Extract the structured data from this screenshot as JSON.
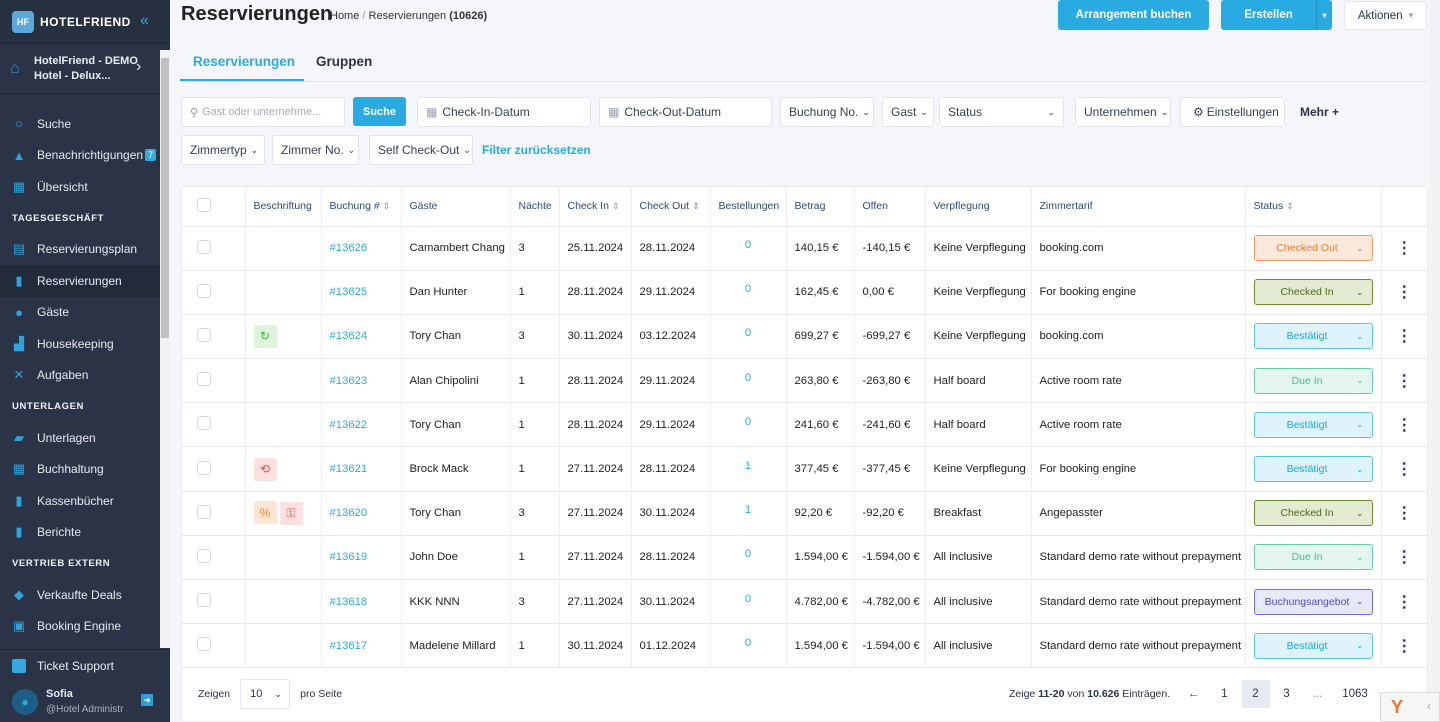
{
  "app": {
    "brand": "HOTELFRIEND",
    "logo_text": "HF"
  },
  "sidebar": {
    "hotel_line1": "HotelFriend - DEMO",
    "hotel_line2": "Hotel - Delux...",
    "items_top": [
      {
        "label": "Suche",
        "icon": "search-icon"
      },
      {
        "label": "Benachrichtigungen",
        "icon": "bell-icon",
        "badge": "7"
      },
      {
        "label": "Übersicht",
        "icon": "dashboard-icon"
      }
    ],
    "section_tagesgeschaeft": "TAGESGESCHÄFT",
    "items_tages": [
      {
        "label": "Reservierungsplan",
        "icon": "calendar-icon"
      },
      {
        "label": "Reservierungen",
        "icon": "document-icon",
        "active": true
      },
      {
        "label": "Gäste",
        "icon": "user-icon"
      },
      {
        "label": "Housekeeping",
        "icon": "broom-icon"
      },
      {
        "label": "Aufgaben",
        "icon": "tools-icon"
      }
    ],
    "section_unterlagen": "UNTERLAGEN",
    "items_unterlagen": [
      {
        "label": "Unterlagen",
        "icon": "folder-icon"
      },
      {
        "label": "Buchhaltung",
        "icon": "calculator-icon"
      },
      {
        "label": "Kassenbücher",
        "icon": "cashbook-icon"
      },
      {
        "label": "Berichte",
        "icon": "clipboard-icon"
      }
    ],
    "section_vertrieb": "VERTRIEB EXTERN",
    "items_vertrieb": [
      {
        "label": "Verkaufte Deals",
        "icon": "tag-icon"
      },
      {
        "label": "Booking Engine",
        "icon": "booking-engine-icon"
      }
    ],
    "ticket_support": "Ticket Support",
    "user_name": "Sofia",
    "user_role": "@Hotel Administr"
  },
  "header": {
    "title": "Reservierungen",
    "breadcrumb_home": "Home",
    "breadcrumb_sep": " / ",
    "breadcrumb_current": "Reservierungen",
    "breadcrumb_count": "(10626)",
    "btn_arrangement": "Arrangement buchen",
    "btn_erstellen": "Erstellen",
    "btn_aktionen": "Aktionen"
  },
  "tabs": [
    {
      "label": "Reservierungen",
      "active": true
    },
    {
      "label": "Gruppen",
      "active": false
    }
  ],
  "filters": {
    "search_placeholder": "Gast oder unternehme...",
    "search_button": "Suche",
    "checkin": "Check-In-Datum",
    "checkout": "Check-Out-Datum",
    "buchung_no": "Buchung No.",
    "gast": "Gast",
    "status": "Status",
    "unternehmen": "Unternehmen",
    "einstellungen": "Einstellungen",
    "mehr": "Mehr +",
    "zimmertyp": "Zimmertyp",
    "zimmer_no": "Zimmer No.",
    "self_checkout": "Self Check-Out",
    "reset": "Filter zurücksetzen"
  },
  "table": {
    "columns": [
      "",
      "Beschriftung",
      "Buchung #",
      "Gäste",
      "Nächte",
      "Check In",
      "Check Out",
      "Bestellungen",
      "Betrag",
      "Offen",
      "Verpflegung",
      "Zimmertarif",
      "Status",
      ""
    ],
    "rows": [
      {
        "tags": [],
        "booking": "#13626",
        "guest": "Camambert Chang",
        "nights": "3",
        "checkin": "25.11.2024",
        "checkout": "28.11.2024",
        "orders": "0",
        "amount": "140,15 €",
        "open": "-140,15 €",
        "board": "Keine Verpflegung",
        "rate": "booking.com",
        "status": "Checked Out",
        "status_type": "checked-out"
      },
      {
        "tags": [],
        "booking": "#13625",
        "guest": "Dan Hunter",
        "nights": "1",
        "checkin": "28.11.2024",
        "checkout": "29.11.2024",
        "orders": "0",
        "amount": "162,45 €",
        "open": "0,00 €",
        "board": "Keine Verpflegung",
        "rate": "For booking engine",
        "status": "Checked In",
        "status_type": "checked-in"
      },
      {
        "tags": [
          "recurring"
        ],
        "booking": "#13624",
        "guest": "Tory Chan",
        "nights": "3",
        "checkin": "30.11.2024",
        "checkout": "03.12.2024",
        "orders": "0",
        "amount": "699,27 €",
        "open": "-699,27 €",
        "board": "Keine Verpflegung",
        "rate": "booking.com",
        "status": "Bestätigt",
        "status_type": "confirmed"
      },
      {
        "tags": [],
        "booking": "#13623",
        "guest": "Alan Chipolini",
        "nights": "1",
        "checkin": "28.11.2024",
        "checkout": "29.11.2024",
        "orders": "0",
        "amount": "263,80 €",
        "open": "-263,80 €",
        "board": "Half board",
        "rate": "Active room rate",
        "status": "Due In",
        "status_type": "due-in"
      },
      {
        "tags": [],
        "booking": "#13622",
        "guest": "Tory Chan",
        "nights": "1",
        "checkin": "28.11.2024",
        "checkout": "29.11.2024",
        "orders": "0",
        "amount": "241,60 €",
        "open": "-241,60 €",
        "board": "Half board",
        "rate": "Active room rate",
        "status": "Bestätigt",
        "status_type": "confirmed"
      },
      {
        "tags": [
          "history"
        ],
        "booking": "#13621",
        "guest": "Brock Mack",
        "nights": "1",
        "checkin": "27.11.2024",
        "checkout": "28.11.2024",
        "orders": "1",
        "amount": "377,45 €",
        "open": "-377,45 €",
        "board": "Keine Verpflegung",
        "rate": "For booking engine",
        "status": "Bestätigt",
        "status_type": "confirmed"
      },
      {
        "tags": [
          "discount",
          "key"
        ],
        "booking": "#13620",
        "guest": "Tory Chan",
        "nights": "3",
        "checkin": "27.11.2024",
        "checkout": "30.11.2024",
        "orders": "1",
        "amount": "92,20 €",
        "open": "-92,20 €",
        "board": "Breakfast",
        "rate": "Angepasster",
        "status": "Checked In",
        "status_type": "checked-in"
      },
      {
        "tags": [],
        "booking": "#13619",
        "guest": "John Doe",
        "nights": "1",
        "checkin": "27.11.2024",
        "checkout": "28.11.2024",
        "orders": "0",
        "amount": "1.594,00 €",
        "open": "-1.594,00 €",
        "board": "All inclusive",
        "rate": "Standard demo rate without prepayment",
        "status": "Due In",
        "status_type": "due-in"
      },
      {
        "tags": [],
        "booking": "#13618",
        "guest": "KKK NNN",
        "nights": "3",
        "checkin": "27.11.2024",
        "checkout": "30.11.2024",
        "orders": "0",
        "amount": "4.782,00 €",
        "open": "-4.782,00 €",
        "board": "All inclusive",
        "rate": "Standard demo rate without prepayment",
        "status": "Buchungsangebot",
        "status_type": "offer"
      },
      {
        "tags": [],
        "booking": "#13617",
        "guest": "Madelene Millard",
        "nights": "1",
        "checkin": "30.11.2024",
        "checkout": "01.12.2024",
        "orders": "0",
        "amount": "1.594,00 €",
        "open": "-1.594,00 €",
        "board": "All inclusive",
        "rate": "Standard demo rate without prepayment",
        "status": "Bestätigt",
        "status_type": "confirmed"
      }
    ]
  },
  "status_colors": {
    "checked-out": {
      "bg": "#fde8dc",
      "border": "#f39a5e",
      "text": "#ef7d32"
    },
    "checked-in": {
      "bg": "#e3ebd3",
      "border": "#6e8a2e",
      "text": "#4e6a16"
    },
    "confirmed": {
      "bg": "#def3fb",
      "border": "#5cc3ea",
      "text": "#1ea7df"
    },
    "due-in": {
      "bg": "#e2f5ee",
      "border": "#6ecba8",
      "text": "#4dbb94"
    },
    "offer": {
      "bg": "#e8e8fb",
      "border": "#6f6fdc",
      "text": "#4c4ccc"
    }
  },
  "footer": {
    "show_label": "Zeigen",
    "per_page": "10",
    "per_page_suffix": "pro Seite",
    "range_prefix": "Zeige ",
    "range": "11-20",
    "range_mid": " von ",
    "total": "10.626",
    "range_suffix": " Einträgen.",
    "pages": [
      "1",
      "2",
      "3",
      "...",
      "1063"
    ],
    "current_page": "2",
    "prev": "←",
    "next": "→"
  },
  "accent_color": "#29abe2"
}
